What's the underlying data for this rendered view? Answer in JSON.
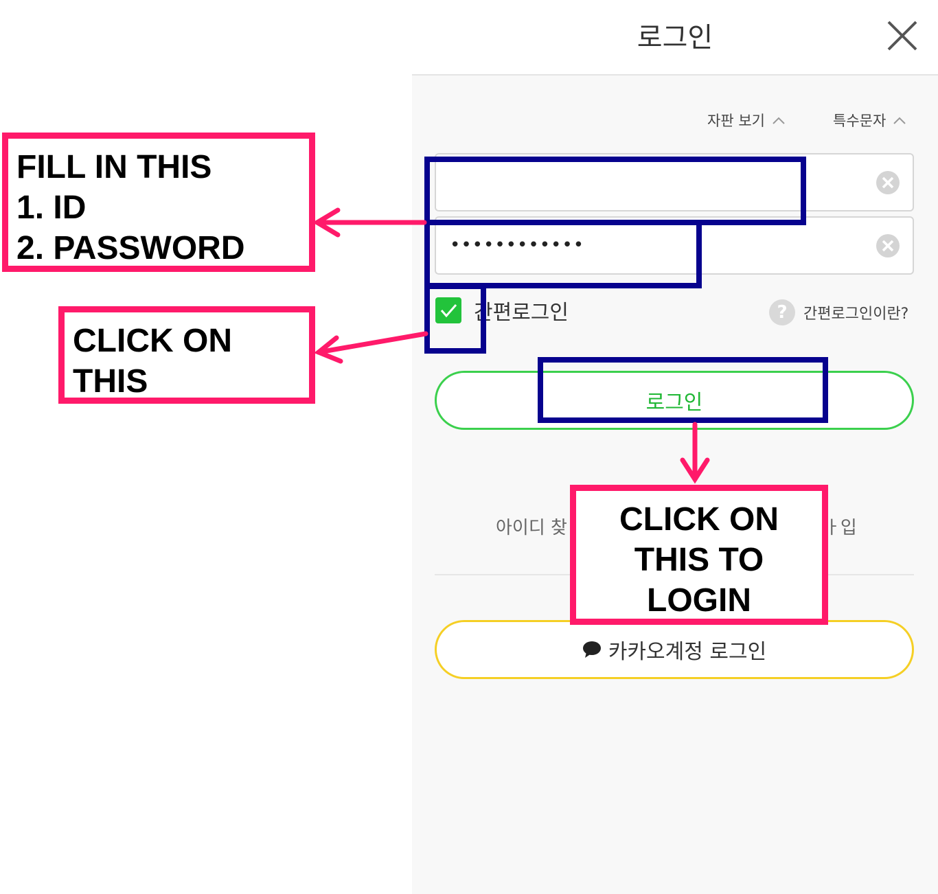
{
  "header": {
    "title": "로그인"
  },
  "keyboard": {
    "keypad_label": "자판 보기",
    "special_label": "특수문자"
  },
  "form": {
    "id_value": "",
    "password_value": "••••••••••••",
    "keep_login_label": "간편로그인",
    "keep_login_checked": true,
    "help_text": "간편로그인이란?",
    "login_button": "로그인"
  },
  "links": {
    "find_id": "아이디 찾",
    "signup_tail": "ㅏ입"
  },
  "kakao": {
    "label": "카카오계정 로그인"
  },
  "annotations": {
    "fill_box": [
      "FILL IN THIS",
      "1.  ID",
      "2.  PASSWORD"
    ],
    "check_box": [
      "CLICK ON",
      "THIS"
    ],
    "login_box": [
      "CLICK ON",
      "THIS TO",
      "LOGIN"
    ]
  },
  "colors": {
    "accent_green": "#22c33b",
    "kakao_yellow": "#f5cf25",
    "annotation_pink": "#ff1a6a",
    "annotation_blue": "#07028e"
  }
}
